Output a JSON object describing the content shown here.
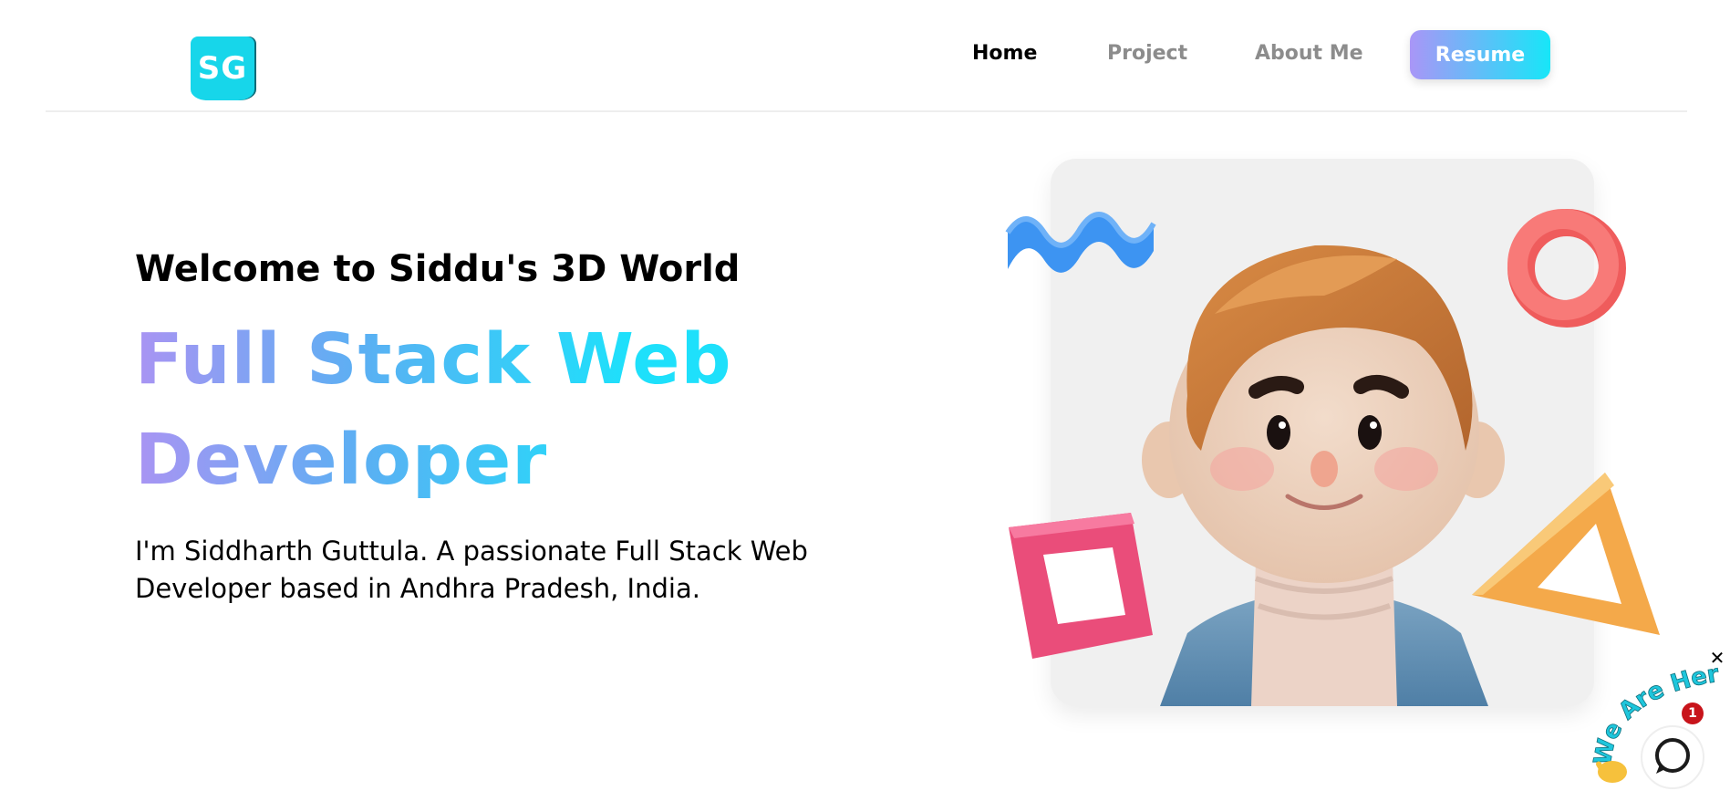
{
  "header": {
    "logo_text": "SG",
    "nav": {
      "home": "Home",
      "project": "Project",
      "about": "About Me"
    },
    "resume_label": "Resume"
  },
  "hero": {
    "welcome": "Welcome to Siddu's 3D World",
    "headline": "Full Stack Web Developer",
    "bio": "I'm Siddharth Guttula. A passionate Full Stack Web Developer based in Andhra Pradesh, India."
  },
  "chat_widget": {
    "tagline": "We Are Here!",
    "unread_count": "1",
    "close_symbol": "✕"
  },
  "colors": {
    "accent_cyan": "#17d6ea",
    "gradient_start": "#a994f3",
    "gradient_end": "#1ee0fb",
    "nav_inactive": "#8c8c8c",
    "badge_red": "#c8141b"
  },
  "icons": {
    "chat": "chat-bubble-icon",
    "wave": "waving-hand-icon",
    "close": "close-icon"
  }
}
